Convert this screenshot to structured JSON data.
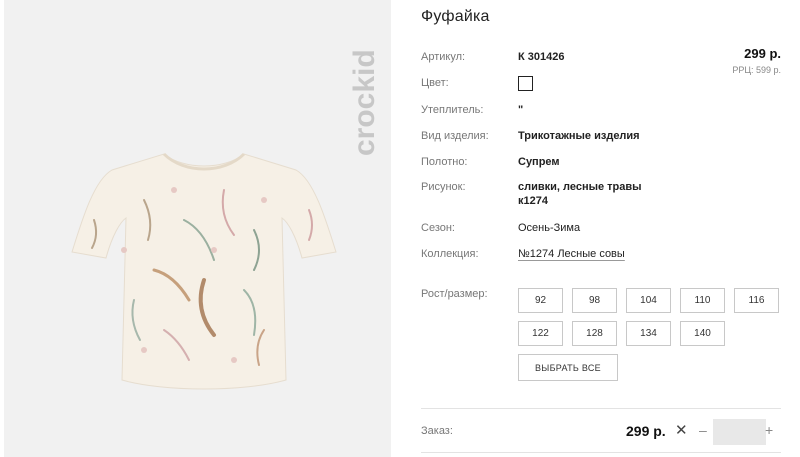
{
  "brand": {
    "logo_text": "crockid"
  },
  "product": {
    "title": "Фуфайка",
    "price": "299 р.",
    "rrp": "РРЦ: 599 р."
  },
  "attributes": [
    {
      "label": "Артикул:",
      "value": "К 301426",
      "style": "bold"
    },
    {
      "label": "Цвет:",
      "value": "",
      "style": "swatch"
    },
    {
      "label": "Утеплитель:",
      "value": "\"",
      "style": "bold"
    },
    {
      "label": "Вид изделия:",
      "value": "Трикотажные изделия",
      "style": "bold"
    },
    {
      "label": "Полотно:",
      "value": "Супрем",
      "style": "bold"
    },
    {
      "label": "Рисунок:",
      "value": "сливки, лесные травы",
      "value2": "к1274",
      "style": "bold"
    },
    {
      "label": "Сезон:",
      "value": "Осень-Зима",
      "style": "normal"
    },
    {
      "label": "Коллекция:",
      "value": "№1274 Лесные совы",
      "style": "link"
    }
  ],
  "sizes": {
    "label": "Рост/размер:",
    "options": [
      "92",
      "98",
      "104",
      "110",
      "116",
      "122",
      "128",
      "134",
      "140"
    ],
    "select_all_label": "ВЫБРАТЬ ВСЕ"
  },
  "order": {
    "label": "Заказ:",
    "price": "299 р.",
    "remove_symbol": "✕",
    "minus_symbol": "–",
    "plus_symbol": "+",
    "quantity": ""
  },
  "colors": {
    "photo_bg": "#f1f1f1",
    "swatch": "#ffffff",
    "border": "#c8c8c8"
  },
  "icons": [
    "crockid-logo",
    "tshirt-image",
    "close-icon",
    "minus-icon",
    "plus-icon"
  ]
}
